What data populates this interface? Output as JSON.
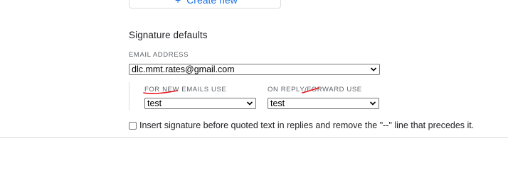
{
  "create_button": {
    "label": "Create new",
    "icon": "plus-icon"
  },
  "signature_defaults": {
    "title": "Signature defaults",
    "email_address_label": "EMAIL ADDRESS",
    "email_address_value": "dlc.mmt.rates@gmail.com",
    "new_emails_label": "FOR NEW EMAILS USE",
    "new_emails_value": "test",
    "reply_forward_label": "ON REPLY/FORWARD USE",
    "reply_forward_value": "test",
    "insert_before_quoted_label": "Insert signature before quoted text in replies and remove the \"--\" line that precedes it.",
    "insert_before_quoted_checked": false
  },
  "colors": {
    "accent": "#1a73e8",
    "annotation": "#e8141c",
    "divider": "#dadce0"
  }
}
